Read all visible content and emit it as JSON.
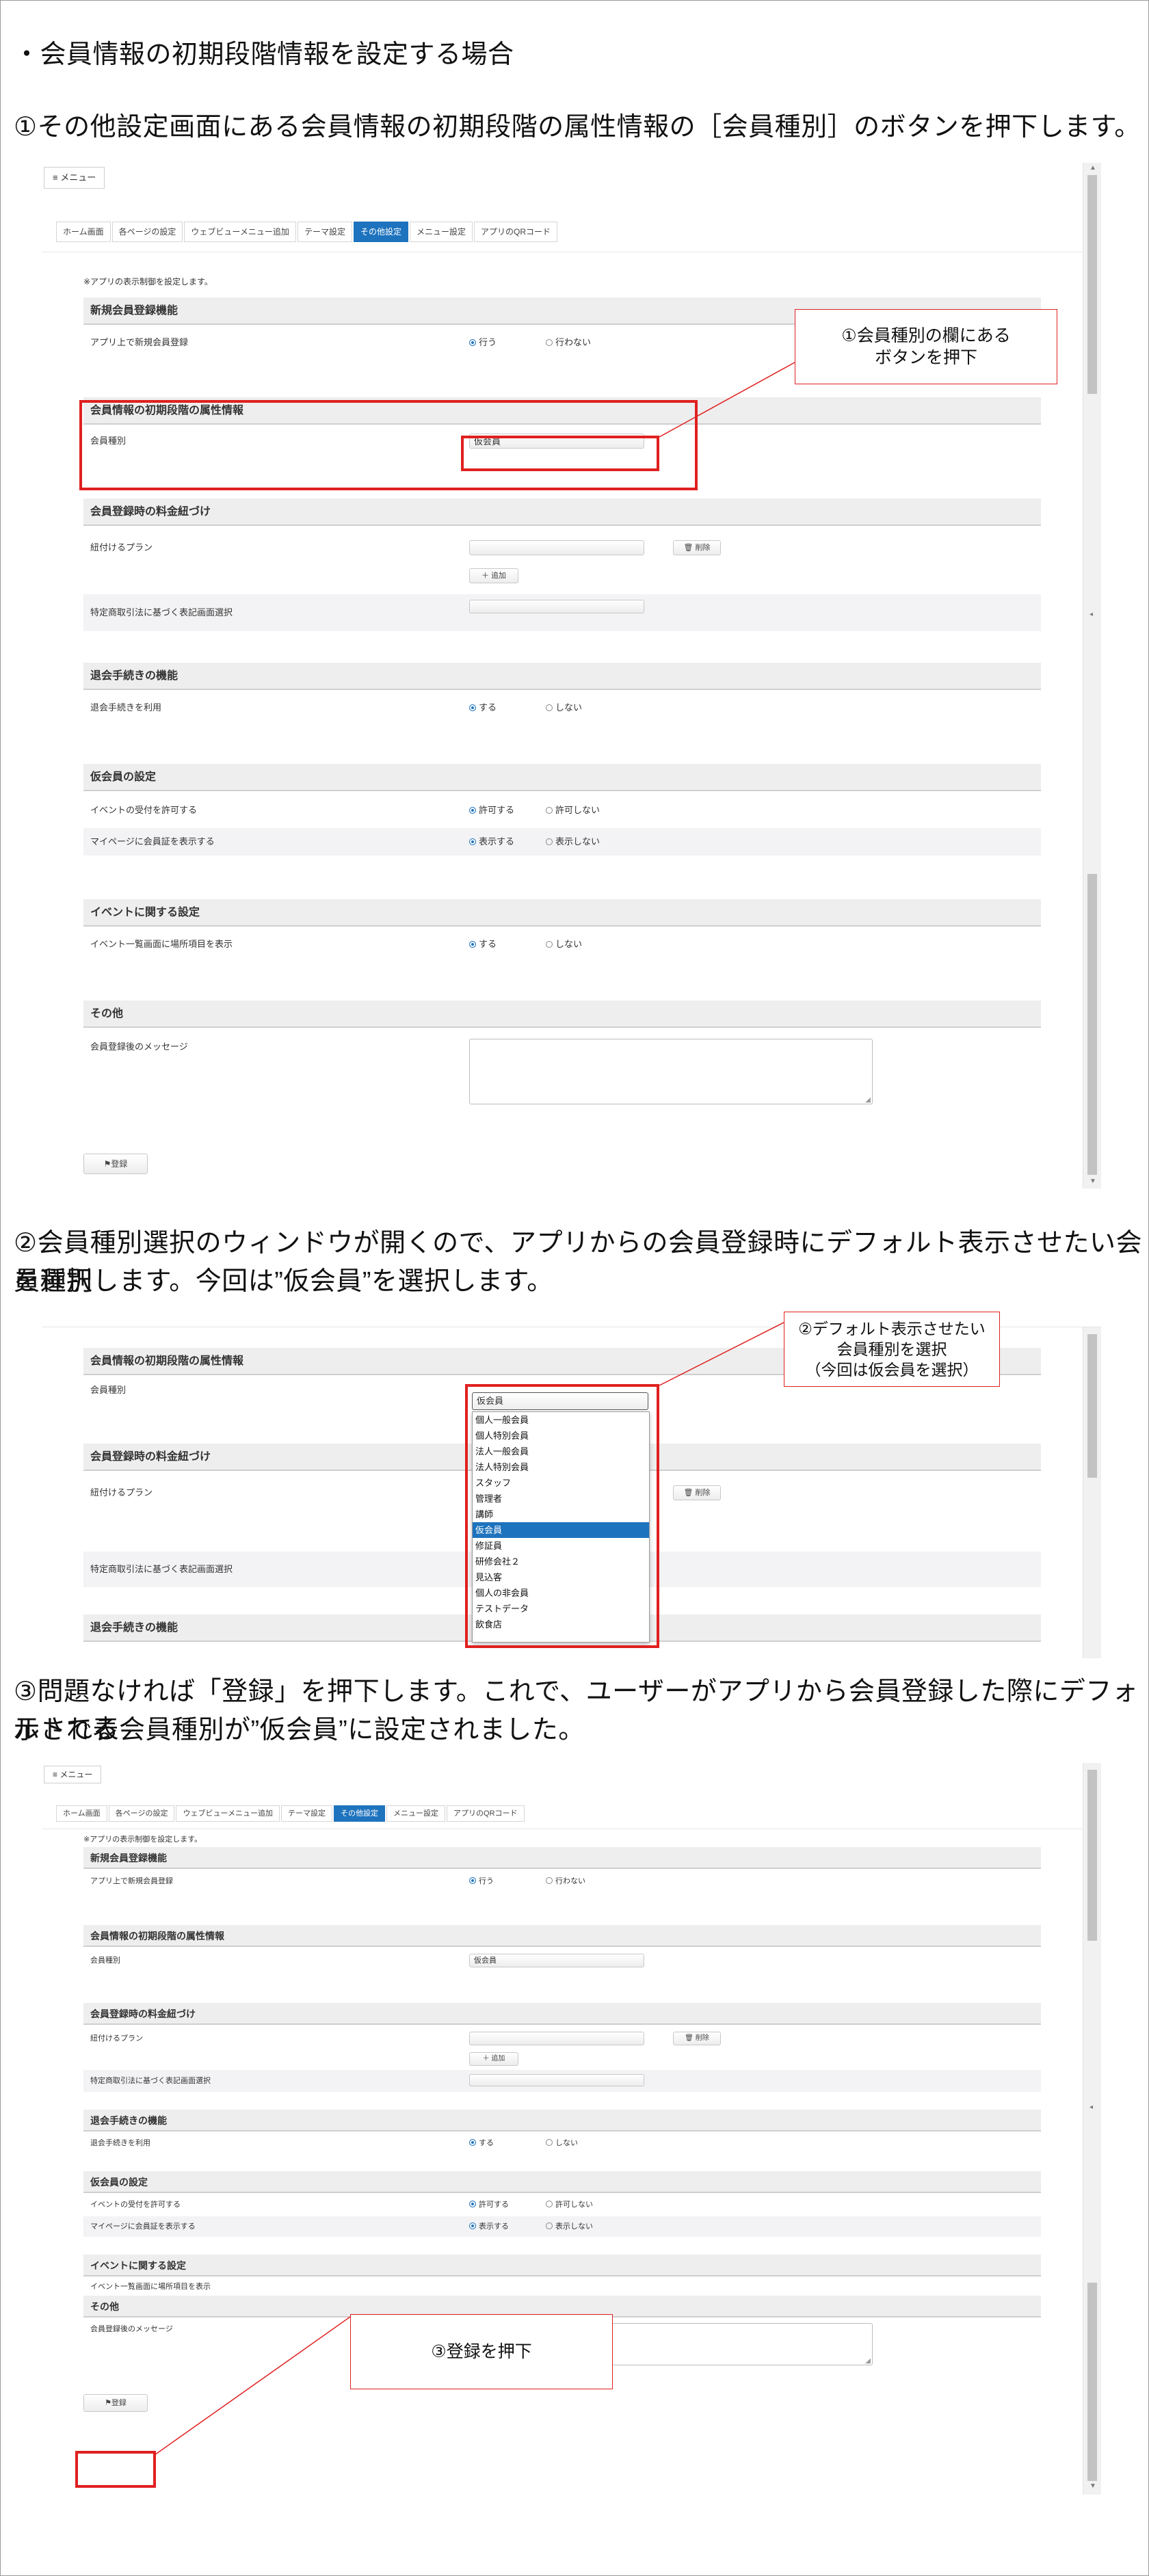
{
  "intro_text": "・会員情報の初期段階情報を設定する場合",
  "step1_text": "①その他設定画面にある会員情報の初期段階の属性情報の［会員種別］のボタンを押下します。",
  "step2_text_line1": "②会員種別選択のウィンドウが開くので、アプリからの会員登録時にデフォルト表示させたい会員種別",
  "step2_text_line2": "を選択します。今回は”仮会員”を選択します。",
  "step3_text_line1": "③問題なければ「登録」を押下します。これで、ユーザーがアプリから会員登録した際にデフォルトで表",
  "step3_text_line2": "示される会員種別が”仮会員”に設定されました。",
  "menu_label": "≡ メニュー",
  "tabs": [
    "ホーム画面",
    "各ページの設定",
    "ウェブビューメニュー追加",
    "テーマ設定",
    "その他設定",
    "メニュー設定",
    "アプリのQRコード"
  ],
  "notice": "※アプリの表示制御を設定します。",
  "sections": {
    "new_member": "新規会員登録機能",
    "initial_attr": "会員情報の初期段階の属性情報",
    "fee": "会員登録時の料金紐づけ",
    "withdraw": "退会手続きの機能",
    "provisional": "仮会員の設定",
    "event": "イベントに関する設定",
    "other": "その他"
  },
  "rows": {
    "app_register": "アプリ上で新規会員登録",
    "member_type": "会員種別",
    "plan": "紐付けるプラン",
    "tokusho": "特定商取引法に基づく表記画面選択",
    "withdraw_use": "退会手続きを利用",
    "event_accept": "イベントの受付を許可する",
    "show_card": "マイページに会員証を表示する",
    "event_place": "イベント一覧画面に場所項目を表示",
    "after_message": "会員登録後のメッセージ"
  },
  "radios": {
    "do": "行う",
    "dont": "行わない",
    "suru": "する",
    "shinai": "しない",
    "allow": "許可する",
    "disallow": "許可しない",
    "show": "表示する",
    "hide": "表示しない"
  },
  "member_type_value": "仮会員",
  "delete_button": "🗑 削除",
  "add_button": "＋ 追加",
  "register_button": "⚑登録",
  "callout1": [
    "①会員種別の欄にある",
    "ボタンを押下"
  ],
  "callout2": [
    "②デフォルト表示させたい",
    "会員種別を選択",
    "（今回は仮会員を選択）"
  ],
  "callout3": [
    "③登録を押下"
  ],
  "dropdown": {
    "selected": "仮会員",
    "options": [
      "個人一般会員",
      "個人特別会員",
      "法人一般会員",
      "法人特別会員",
      "スタッフ",
      "管理者",
      "講師",
      "仮会員",
      "修証員",
      "研修会社２",
      "見込客",
      "個人の非会員",
      "テストデータ",
      "飲食店"
    ],
    "highlighted_index": 7
  },
  "colors": {
    "accent": "#1e73be",
    "highlight_red": "#e02020"
  }
}
